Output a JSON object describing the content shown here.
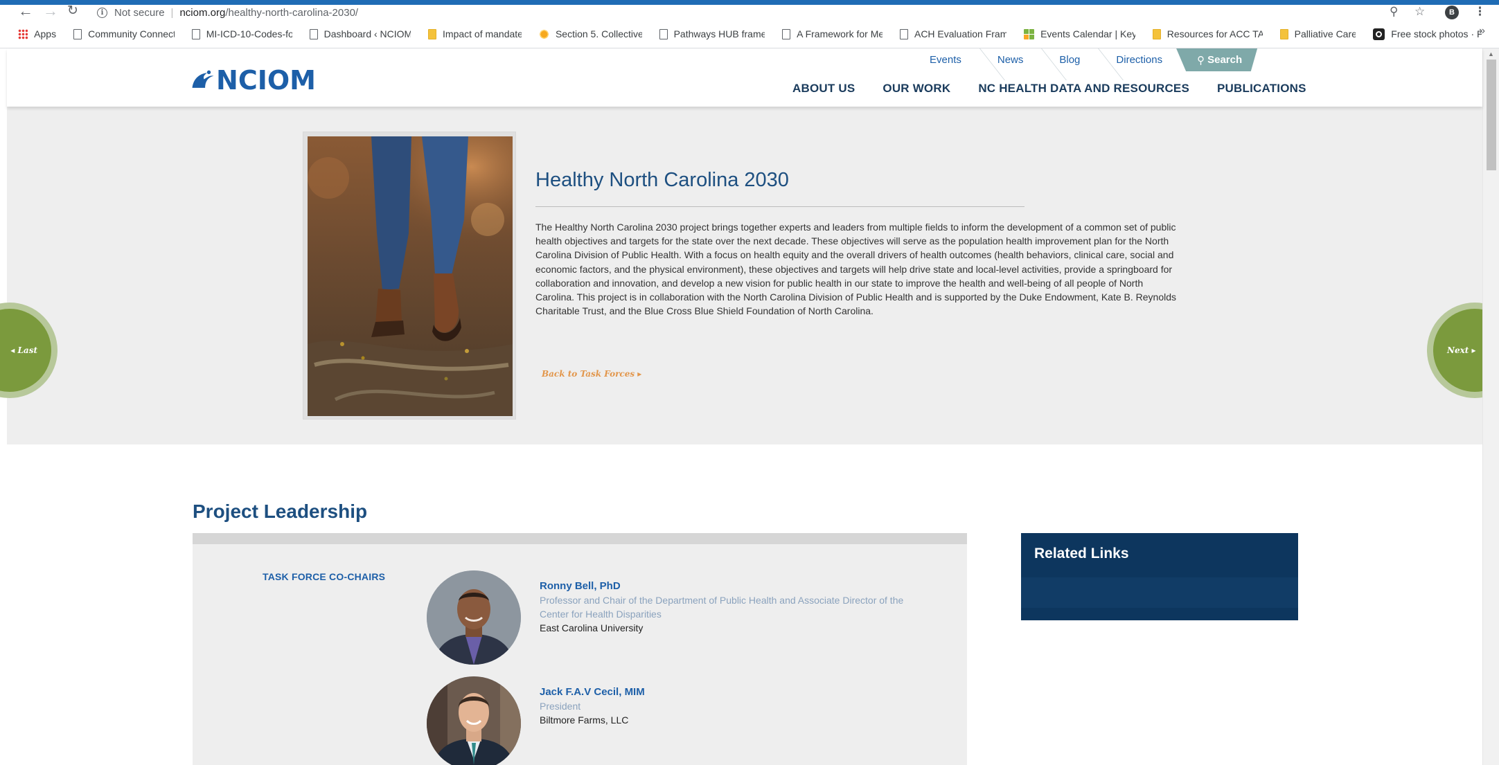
{
  "browser": {
    "security_label": "Not secure",
    "url_host": "nciom.org",
    "url_path": "/healthy-north-carolina-2030/",
    "profile_initial": "B",
    "bookmarks": [
      {
        "label": "Apps",
        "icon": "apps-icon"
      },
      {
        "label": "Community Connect",
        "icon": "page-icon"
      },
      {
        "label": "MI-ICD-10-Codes-fo",
        "icon": "page-icon"
      },
      {
        "label": "Dashboard ‹ NCIOM",
        "icon": "page-icon"
      },
      {
        "label": "Impact of mandate",
        "icon": "folder-icon"
      },
      {
        "label": "Section 5. Collective",
        "icon": "sun-icon"
      },
      {
        "label": "Pathways HUB frame",
        "icon": "page-icon"
      },
      {
        "label": "A Framework for Me",
        "icon": "page-icon"
      },
      {
        "label": "ACH Evaluation Fram",
        "icon": "page-icon"
      },
      {
        "label": "Events Calendar | Key",
        "icon": "grid-icon"
      },
      {
        "label": "Resources for ACC TA",
        "icon": "folder-icon"
      },
      {
        "label": "Palliative Care",
        "icon": "folder-icon"
      },
      {
        "label": "Free stock photos · P",
        "icon": "camera-icon"
      }
    ],
    "more": "»"
  },
  "site": {
    "logo_text": "NCIOM",
    "util_nav": [
      "Events",
      "News",
      "Blog",
      "Directions"
    ],
    "search_label": "Search",
    "main_nav": [
      "ABOUT US",
      "OUR WORK",
      "NC HEALTH DATA AND RESOURCES",
      "PUBLICATIONS"
    ]
  },
  "hero": {
    "title": "Healthy North Carolina 2030",
    "body": "The Healthy North Carolina 2030 project brings together experts and leaders from multiple fields to inform the development of a common set of public health objectives and targets for the state over the next decade. These objectives will serve as the population health improvement plan for the North Carolina Division of Public Health. With a focus on health equity and the overall drivers of health outcomes (health behaviors, clinical care, social and economic factors, and the physical environment), these objectives and targets will help drive state and local-level activities, provide a springboard for collaboration and innovation, and develop a new vision for public health in our state to improve the health and well-being of all people of North Carolina. This project is in collaboration with the North Carolina Division of Public Health and is supported by the Duke Endowment, Kate B. Reynolds Charitable Trust, and the Blue Cross Blue Shield Foundation of North Carolina.",
    "back_link": "Back to Task Forces ▸",
    "prev_label": "◂ Last",
    "next_label": "Next ▸"
  },
  "leadership": {
    "title": "Project Leadership",
    "group_label": "TASK FORCE CO-CHAIRS",
    "people": [
      {
        "name": "Ronny Bell, PhD",
        "role": "Professor and Chair of the Department of Public Health and Associate Director of the Center for Health Disparities",
        "org": "East Carolina University"
      },
      {
        "name": "Jack F.A.V Cecil, MIM",
        "role": "President",
        "org": "Biltmore Farms, LLC"
      }
    ]
  },
  "related": {
    "title": "Related Links"
  },
  "colors": {
    "brand_blue": "#1d5fa8",
    "heading_blue": "#1d4f80",
    "related_bg": "#0d365e",
    "accent_orange": "#e2964b",
    "side_green": "#7b9a3d",
    "search_teal": "#7fa9a9"
  }
}
